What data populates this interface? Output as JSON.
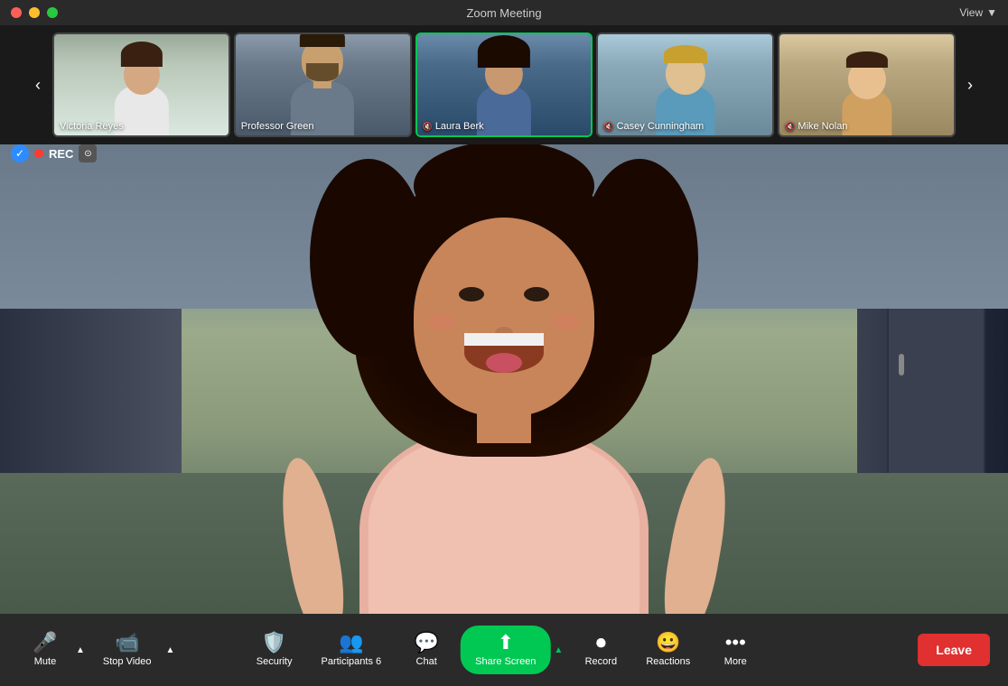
{
  "app": {
    "title": "Zoom Meeting"
  },
  "titlebar": {
    "title": "Zoom Meeting",
    "view_label": "View",
    "buttons": {
      "close": "close",
      "minimize": "minimize",
      "maximize": "maximize"
    }
  },
  "recording": {
    "check_icon": "✓",
    "dot": "●",
    "label": "REC",
    "camera_icon": "⊙"
  },
  "participants": [
    {
      "name": "Victoria Reyes",
      "id": "victoria",
      "active": false,
      "mic_on": true
    },
    {
      "name": "Professor Green",
      "id": "professor",
      "active": false,
      "mic_on": true
    },
    {
      "name": "Laura Berk",
      "id": "laura",
      "active": true,
      "mic_on": false,
      "mic_icon": "🔇"
    },
    {
      "name": "Casey Cunningham",
      "id": "casey",
      "active": false,
      "mic_on": false,
      "mic_icon": "🔇"
    },
    {
      "name": "Mike Nolan",
      "id": "mike",
      "active": false,
      "mic_on": false,
      "mic_icon": "🔇"
    }
  ],
  "main_speaker": {
    "name": "Laura Berk"
  },
  "toolbar": {
    "mute_label": "Mute",
    "stop_video_label": "Stop Video",
    "security_label": "Security",
    "participants_label": "Participants",
    "participants_count": "6",
    "chat_label": "Chat",
    "share_screen_label": "Share Screen",
    "record_label": "Record",
    "reactions_label": "Reactions",
    "more_label": "More",
    "leave_label": "Leave"
  },
  "nav": {
    "prev_icon": "‹",
    "next_icon": "›"
  },
  "colors": {
    "active_border": "#2d8cff",
    "speaking_border": "#00c853",
    "toolbar_bg": "#2a2a2a",
    "share_active": "#00c853",
    "leave_btn": "#e03030",
    "recording_dot": "#ff3b30"
  }
}
